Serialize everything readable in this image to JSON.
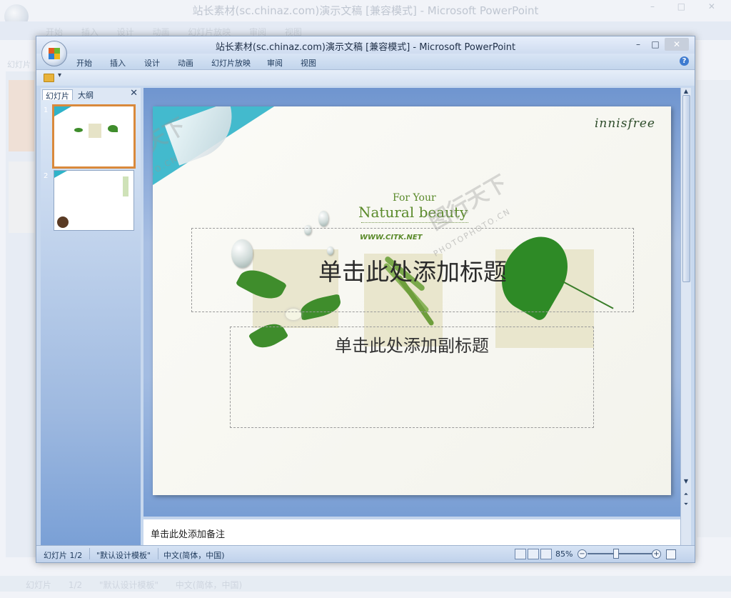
{
  "window": {
    "title": "站长素材(sc.chinaz.com)演示文稿 [兼容模式] - Microsoft PowerPoint",
    "min_glyph": "–",
    "max_glyph": "□",
    "close_glyph": "✕"
  },
  "background_window": {
    "title": "站长素材(sc.chinaz.com)演示文稿 [兼容模式] - Microsoft PowerPoint",
    "menus": "开始 插入 设计 动画 幻灯片放映 审阅 视图",
    "panel_tab": "幻灯片",
    "status": "幻灯片 1/2 \"默认设计模板\" 中文(简体，中国)",
    "controls": "– □ ✕"
  },
  "ribbon": {
    "tabs": [
      "开始",
      "插入",
      "设计",
      "动画",
      "幻灯片放映",
      "审阅",
      "视图"
    ],
    "help_glyph": "?"
  },
  "qat": {
    "dropdown_glyph": "▾"
  },
  "pane": {
    "tabs": [
      "幻灯片",
      "大纲"
    ],
    "close_glyph": "✕",
    "slide_numbers": [
      "1",
      "2"
    ]
  },
  "slide": {
    "brand": "innisfree",
    "for_your": "For Your",
    "natural_beauty": "Natural beauty",
    "tagline": "WWW.CITK.NET",
    "title_placeholder": "单击此处添加标题",
    "subtitle_placeholder": "单击此处添加副标题"
  },
  "notes": {
    "placeholder": "单击此处添加备注"
  },
  "status": {
    "slide_position": "幻灯片 1/2",
    "theme": "\"默认设计模板\"",
    "language": "中文(简体，中国)",
    "zoom": "85%",
    "zoom_out": "−",
    "zoom_in": "+"
  },
  "watermark": {
    "text": "图行天下",
    "sub": "PHOTOPHOTO.CN"
  },
  "colors": {
    "accent_teal": "#2fb3c9",
    "leaf_green": "#3f8d2c",
    "selected_thumb_border": "#d9893c"
  }
}
